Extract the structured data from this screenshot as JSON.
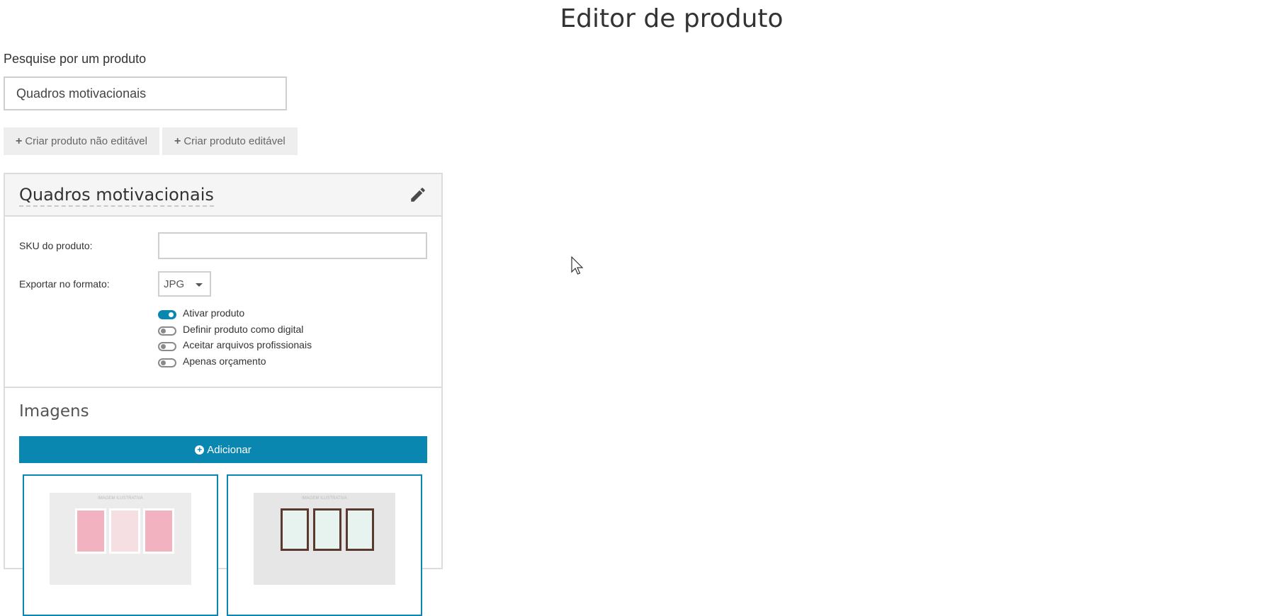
{
  "page": {
    "title": "Editor de produto"
  },
  "search": {
    "label": "Pesquise por um produto",
    "value": "Quadros motivacionais"
  },
  "actions": {
    "create_non_editable": "Criar produto não editável",
    "create_editable": "Criar produto editável"
  },
  "product": {
    "name": "Quadros motivacionais",
    "sku_label": "SKU do produto:",
    "sku_value": "",
    "export_label": "Exportar no formato:",
    "export_format": "JPG",
    "toggles": [
      {
        "label": "Ativar produto",
        "on": true
      },
      {
        "label": "Definir produto como digital",
        "on": false
      },
      {
        "label": "Aceitar arquivos profissionais",
        "on": false
      },
      {
        "label": "Apenas orçamento",
        "on": false
      }
    ]
  },
  "images": {
    "title": "Imagens",
    "add_label": "Adicionar",
    "caption": "IMAGEM ILUSTRATIVA",
    "items": [
      {
        "name": "pink-frames"
      },
      {
        "name": "dark-frames"
      }
    ]
  },
  "colors": {
    "accent": "#0a87b1",
    "border": "#dcdcdc",
    "button_gray": "#eeeeee"
  }
}
